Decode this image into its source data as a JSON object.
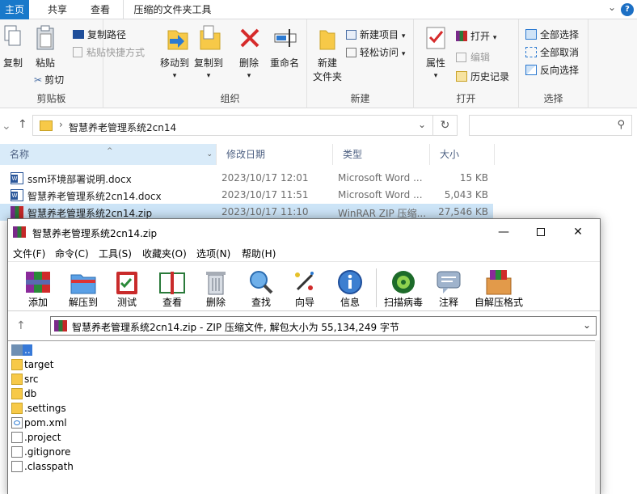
{
  "explorer": {
    "tabs": [
      "主页",
      "共享",
      "查看",
      "压缩的文件夹工具"
    ],
    "help_icon": "?",
    "clipboard": {
      "group": "剪贴板",
      "copy": "复制",
      "paste": "粘贴",
      "copy_path": "复制路径",
      "paste_shortcut": "粘贴快捷方式",
      "cut": "剪切"
    },
    "organize": {
      "group": "组织",
      "move_to": "移动到",
      "copy_to": "复制到",
      "delete": "删除",
      "rename": "重命名"
    },
    "new": {
      "group": "新建",
      "new_folder_1": "新建",
      "new_folder_2": "文件夹",
      "new_item": "新建项目",
      "easy_access": "轻松访问"
    },
    "open": {
      "group": "打开",
      "properties": "属性",
      "open": "打开",
      "edit": "编辑",
      "history": "历史记录"
    },
    "select": {
      "group": "选择",
      "select_all": "全部选择",
      "select_none": "全部取消",
      "invert": "反向选择"
    },
    "path": "智慧养老管理系统2cn14",
    "columns": [
      "名称",
      "修改日期",
      "类型",
      "大小"
    ],
    "files": [
      {
        "name": "ssm环境部署说明.docx",
        "date": "2023/10/17 12:01",
        "type": "Microsoft Word ...",
        "size": "15 KB",
        "icon": "word-icon"
      },
      {
        "name": "智慧养老管理系统2cn14.docx",
        "date": "2023/10/17 11:51",
        "type": "Microsoft Word ...",
        "size": "5,043 KB",
        "icon": "word-icon"
      },
      {
        "name": "智慧养老管理系统2cn14.zip",
        "date": "2023/10/17 11:10",
        "type": "WinRAR ZIP 压缩...",
        "size": "27,546 KB",
        "icon": "winrar-icon"
      }
    ]
  },
  "winrar": {
    "title": "智慧养老管理系统2cn14.zip",
    "menu": [
      "文件(F)",
      "命令(C)",
      "工具(S)",
      "收藏夹(O)",
      "选项(N)",
      "帮助(H)"
    ],
    "toolbar": [
      "添加",
      "解压到",
      "测试",
      "查看",
      "删除",
      "查找",
      "向导",
      "信息",
      "扫描病毒",
      "注释",
      "自解压格式"
    ],
    "path_text": "智慧养老管理系统2cn14.zip - ZIP 压缩文件, 解包大小为 55,134,249 字节",
    "items": [
      {
        "name": "..",
        "icon": "parent-folder-icon"
      },
      {
        "name": "target",
        "icon": "folder-icon"
      },
      {
        "name": "src",
        "icon": "folder-icon"
      },
      {
        "name": "db",
        "icon": "folder-icon"
      },
      {
        "name": ".settings",
        "icon": "folder-icon"
      },
      {
        "name": "pom.xml",
        "icon": "xml-file-icon"
      },
      {
        "name": ".project",
        "icon": "file-icon"
      },
      {
        "name": ".gitignore",
        "icon": "file-icon"
      },
      {
        "name": ".classpath",
        "icon": "file-icon"
      }
    ]
  }
}
